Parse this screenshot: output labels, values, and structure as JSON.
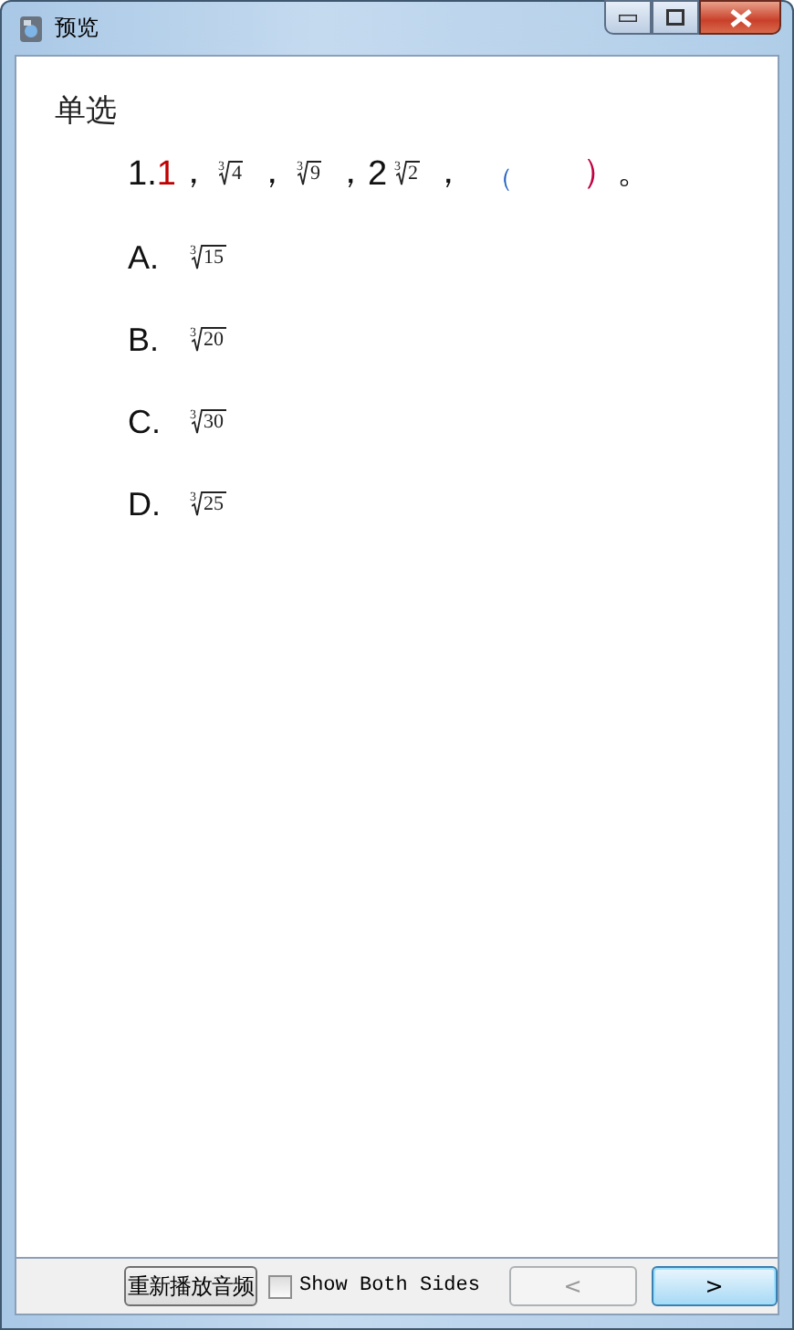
{
  "window": {
    "title": "预览"
  },
  "question_type": "单选",
  "question": [
    {
      "kind": "text",
      "text": "1."
    },
    {
      "kind": "text",
      "text": "1",
      "color": "#c00000"
    },
    {
      "kind": "text",
      "text": "，"
    },
    {
      "kind": "radical",
      "index": "3",
      "radicand": "4"
    },
    {
      "kind": "text",
      "text": "，"
    },
    {
      "kind": "radical",
      "index": "3",
      "radicand": "9"
    },
    {
      "kind": "text",
      "text": "，"
    },
    {
      "kind": "text",
      "text": "2"
    },
    {
      "kind": "radical",
      "index": "3",
      "radicand": "2"
    },
    {
      "kind": "text",
      "text": "，"
    },
    {
      "kind": "gap-open",
      "text": "（",
      "color": "#1f5fbf"
    },
    {
      "kind": "text",
      "text": "）",
      "color": "#c00040"
    },
    {
      "kind": "text",
      "text": "。"
    }
  ],
  "options": [
    {
      "label": "A.",
      "index": "3",
      "radicand": "15"
    },
    {
      "label": "B.",
      "index": "3",
      "radicand": "20"
    },
    {
      "label": "C.",
      "index": "3",
      "radicand": "30"
    },
    {
      "label": "D.",
      "index": "3",
      "radicand": "25"
    }
  ],
  "footer": {
    "replay_button": "重新播放音频",
    "show_both_sides": {
      "label": "Show Both Sides",
      "checked": false
    },
    "prev_button": {
      "text": "<",
      "disabled": true
    },
    "next_button": {
      "text": ">",
      "focused": true
    }
  }
}
